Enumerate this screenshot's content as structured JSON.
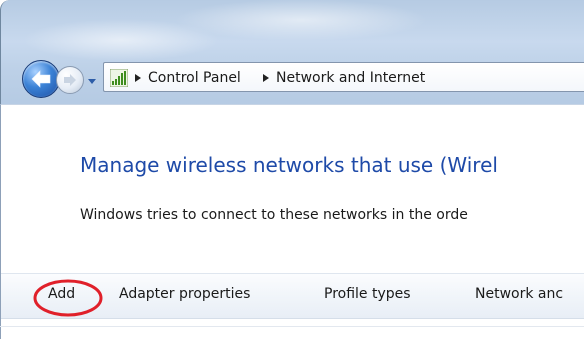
{
  "navigation": {
    "back_button": "back",
    "forward_button": "forward",
    "recent_pages_dropdown": "recent-pages",
    "address_icon": "network-signal-icon",
    "breadcrumbs": [
      {
        "label": "Control Panel"
      },
      {
        "label": "Network and Internet"
      }
    ]
  },
  "main": {
    "title": "Manage wireless networks that use (Wirel",
    "description": "Windows tries to connect to these networks in the orde"
  },
  "toolbar": {
    "items": [
      {
        "label": "Add"
      },
      {
        "label": "Adapter properties"
      },
      {
        "label": "Profile types"
      },
      {
        "label": "Network anc"
      }
    ]
  },
  "colors": {
    "title_blue": "#1e4aa8",
    "highlight_red": "#e0202a",
    "glass_blue": "#bcd0e7"
  }
}
